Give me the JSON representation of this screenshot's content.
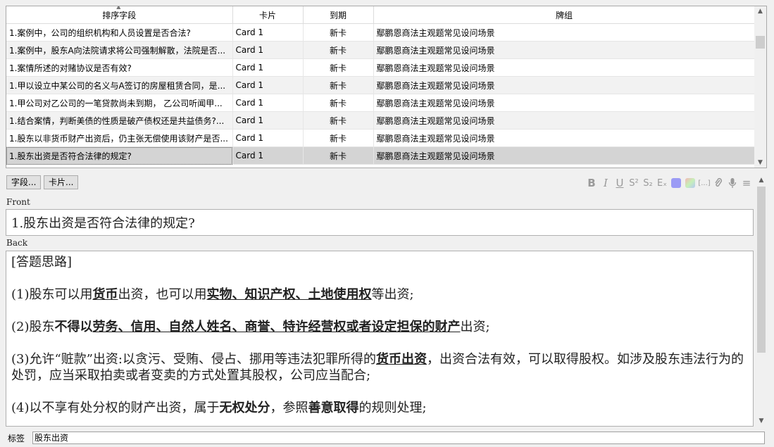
{
  "table": {
    "columns": [
      "排序字段",
      "卡片",
      "到期",
      "牌组"
    ],
    "rows": [
      {
        "sort_field": "1.案例中，公司的组织机构和人员设置是否合法?",
        "card": "Card 1",
        "due": "新卡",
        "deck": "鄢鹏恩商法主观题常见设问场景"
      },
      {
        "sort_field": "1.案例中，股东A向法院请求将公司强制解散，法院是否...",
        "card": "Card 1",
        "due": "新卡",
        "deck": "鄢鹏恩商法主观题常见设问场景"
      },
      {
        "sort_field": "1.案情所述的对赌协议是否有效?",
        "card": "Card 1",
        "due": "新卡",
        "deck": "鄢鹏恩商法主观题常见设问场景"
      },
      {
        "sort_field": "1.甲以设立中某公司的名义与A签订的房屋租赁合同，是...",
        "card": "Card 1",
        "due": "新卡",
        "deck": "鄢鹏恩商法主观题常见设问场景"
      },
      {
        "sort_field": "1.甲公司对乙公司的一笔贷款尚未到期， 乙公司听闻甲...",
        "card": "Card 1",
        "due": "新卡",
        "deck": "鄢鹏恩商法主观题常见设问场景"
      },
      {
        "sort_field": "1.结合案情，判断美债的性质是破产债权还是共益债务?...",
        "card": "Card 1",
        "due": "新卡",
        "deck": "鄢鹏恩商法主观题常见设问场景"
      },
      {
        "sort_field": "1.股东以非货币财产出资后，仍主张无偿使用该财产是否...",
        "card": "Card 1",
        "due": "新卡",
        "deck": "鄢鹏恩商法主观题常见设问场景"
      },
      {
        "sort_field": "1.股东出资是否符合法律的规定?",
        "card": "Card 1",
        "due": "新卡",
        "deck": "鄢鹏恩商法主观题常见设问场景",
        "selected": true
      }
    ]
  },
  "buttons": {
    "fields": "字段...",
    "cards": "卡片..."
  },
  "toolbar_icons": [
    "bold-icon",
    "italic-icon",
    "underline-icon",
    "superscript-icon",
    "subscript-icon",
    "clear-format-icon",
    "text-color-icon",
    "highlight-color-icon",
    "cloze-icon",
    "attach-icon",
    "record-audio-icon",
    "more-icon"
  ],
  "toolbar_glyphs": {
    "bold": "B",
    "italic": "I",
    "underline": "U",
    "superscript": "S²",
    "subscript": "S₂",
    "clear": "Eₓ",
    "cloze": "[...]",
    "attach": "⌕",
    "record": "●",
    "more": "≡"
  },
  "colors": {
    "text_color_swatch": "#9b9bf5",
    "highlight_swatch": "#c6f0b8",
    "selected_row": "#d4d4d4"
  },
  "editor": {
    "front_label": "Front",
    "front_value": "1.股东出资是否符合法律的规定?",
    "back_label": "Back",
    "back": {
      "heading": "[答题思路]",
      "p1": {
        "a": "(1)股东可以用",
        "b": "货币",
        "c": "出资，也可以用",
        "d": "实物、知识产权、土地使用权",
        "e": "等出资;"
      },
      "p2": {
        "a": "(2)股东",
        "b": "不得以",
        "c": "劳务、信用、自然人姓名、商誉、特许经营权或者设定担保的财产",
        "d": "出资;"
      },
      "p3": {
        "a": "(3)允许“赃款”出资:以贪污、受贿、侵占、挪用等违法犯罪所得的",
        "b": "货币出资",
        "c": "，出资合法有效，可以取得股权。如涉及股东违法行为的处罚，应当采取拍卖或者变卖的方式处置其股权，公司应当配合;"
      },
      "p4": {
        "a": "(4)以不享有处分权的财产出资，属于",
        "b": "无权处分",
        "c": "，参照",
        "d": "善意取得",
        "e": "的规则处理;"
      }
    }
  },
  "tags": {
    "label": "标签",
    "value": "股东出资"
  }
}
